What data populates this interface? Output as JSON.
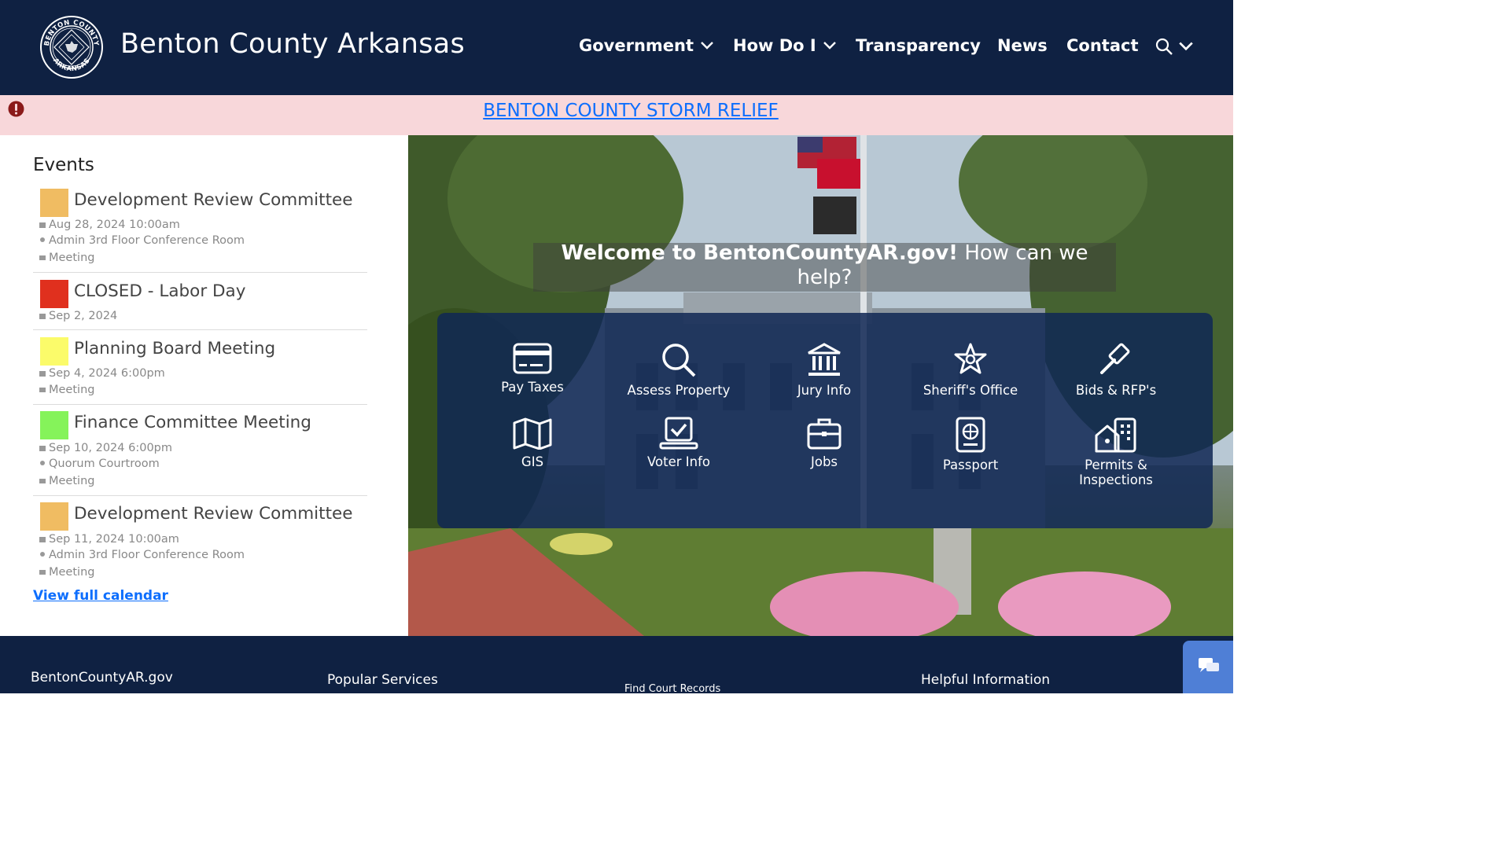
{
  "header": {
    "site_title": "Benton County Arkansas",
    "seal_text_top": "BENTON COUNTY",
    "seal_text_bottom": "ARKANSAS",
    "nav": [
      {
        "label": "Government",
        "has_dropdown": true
      },
      {
        "label": "How Do I",
        "has_dropdown": true
      },
      {
        "label": "Transparency",
        "has_dropdown": false
      },
      {
        "label": "News",
        "has_dropdown": false
      },
      {
        "label": "Contact",
        "has_dropdown": false
      }
    ],
    "search_icon": "search-icon"
  },
  "alert": {
    "icon": "exclamation-circle-icon",
    "link_text": "BENTON COUNTY STORM RELIEF"
  },
  "events": {
    "heading": "Events",
    "items": [
      {
        "color": "#f0bc62",
        "title": "Development Review Committee",
        "date": "Aug 28, 2024 10:00am",
        "location": "Admin 3rd Floor Conference Room",
        "category": "Meeting"
      },
      {
        "color": "#e0301e",
        "title": "CLOSED - Labor Day",
        "date": "Sep 2, 2024"
      },
      {
        "color": "#fbfb6a",
        "title": "Planning Board Meeting",
        "date": "Sep 4, 2024 6:00pm",
        "category": "Meeting"
      },
      {
        "color": "#85f35a",
        "title": "Finance Committee Meeting",
        "date": "Sep 10, 2024 6:00pm",
        "location": "Quorum Courtroom",
        "category": "Meeting"
      },
      {
        "color": "#f0bc62",
        "title": "Development Review Committee",
        "date": "Sep 11, 2024 10:00am",
        "location": "Admin 3rd Floor Conference Room",
        "category": "Meeting"
      }
    ],
    "view_full_calendar": "View full calendar"
  },
  "hero": {
    "welcome_bold": "Welcome to BentonCountyAR.gov!",
    "welcome_rest": "How can we help?",
    "services": [
      {
        "label": "Pay Taxes",
        "icon": "credit-card-icon"
      },
      {
        "label": "Assess Property",
        "icon": "magnifier-icon"
      },
      {
        "label": "Jury Info",
        "icon": "courthouse-icon"
      },
      {
        "label": "Sheriff's Office",
        "icon": "sheriff-star-icon"
      },
      {
        "label": "Bids & RFP's",
        "icon": "gavel-icon"
      },
      {
        "label": "GIS",
        "icon": "map-icon"
      },
      {
        "label": "Voter Info",
        "icon": "ballot-box-icon"
      },
      {
        "label": "Jobs",
        "icon": "briefcase-icon"
      },
      {
        "label": "Passport",
        "icon": "passport-icon"
      },
      {
        "label": "Permits & Inspections",
        "icon": "buildings-icon"
      }
    ]
  },
  "footer": {
    "col1": "BentonCountyAR.gov",
    "col2": "Popular Services",
    "col3": "Find Court Records",
    "col4": "Helpful Information"
  },
  "chat": {
    "icon": "chat-bubbles-icon"
  }
}
